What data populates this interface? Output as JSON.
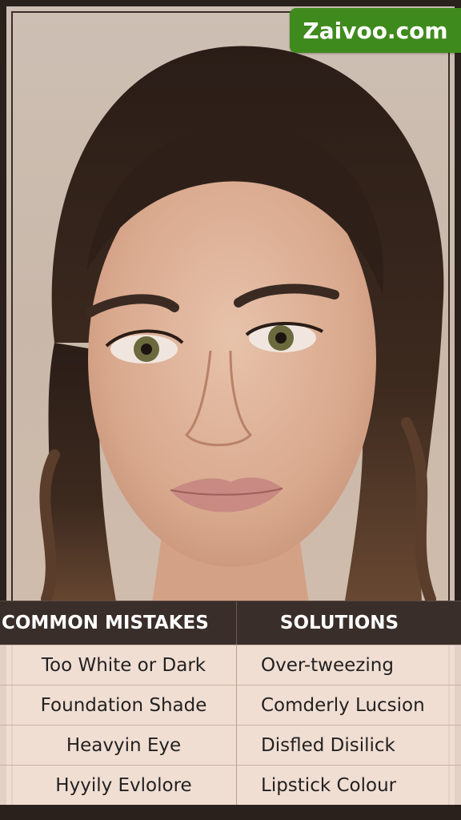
{
  "badge": {
    "text": "Zaivoo.com",
    "color": "#3f8a1d"
  },
  "table": {
    "headers": [
      "COMMON MISTAKES",
      "SOLUTIONS"
    ],
    "rows": [
      [
        "Too White or Dark",
        "Over-tweezing"
      ],
      [
        "Foundation Shade",
        "Comderly Lucsion"
      ],
      [
        "Heavyin Eye",
        "Disfled Disilick"
      ],
      [
        "Hyyily Evlolore",
        "Lipstick Colour"
      ]
    ]
  }
}
